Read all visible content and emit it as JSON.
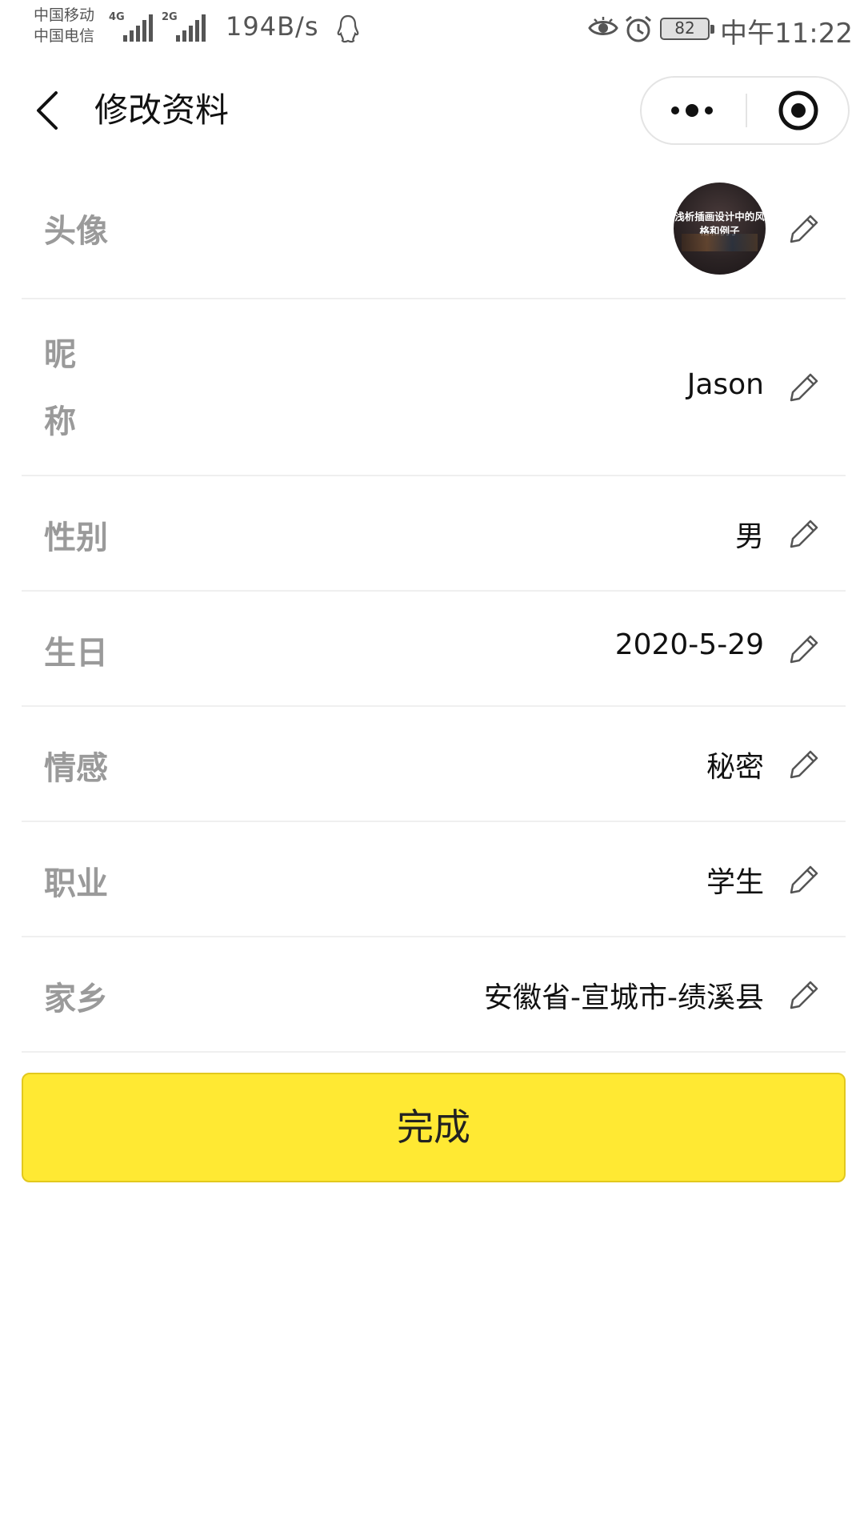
{
  "status_bar": {
    "carrier_1": "中国移动",
    "carrier_2": "中国电信",
    "signal_1_tag": "4G",
    "signal_2_tag": "2G",
    "net_speed": "194B/s",
    "battery": "82",
    "time": "中午11:22",
    "icons": [
      "qq-icon",
      "eye-icon",
      "alarm-icon",
      "battery-icon"
    ]
  },
  "header": {
    "title": "修改资料",
    "back_icon": "chevron-left-icon",
    "more_icon": "more-dots-icon",
    "close_icon": "target-circle-icon"
  },
  "form": {
    "avatar": {
      "label": "头像",
      "caption": "浅析插画设计中的风格和例子"
    },
    "nickname": {
      "label_line1": "昵",
      "label_line2": "称",
      "value": "Jason"
    },
    "gender": {
      "label": "性别",
      "value": "男"
    },
    "birthday": {
      "label": "生日",
      "value": "2020-5-29"
    },
    "relationship": {
      "label": "情感",
      "value": "秘密"
    },
    "occupation": {
      "label": "职业",
      "value": "学生"
    },
    "hometown": {
      "label": "家乡",
      "value": "安徽省-宣城市-绩溪县"
    },
    "edit_icon": "pencil-icon"
  },
  "done_button": {
    "label": "完成"
  },
  "colors": {
    "accent": "#ffe933",
    "accent_border": "#e2c81e",
    "label_gray": "#9a9a9a",
    "divider": "#efefef"
  }
}
